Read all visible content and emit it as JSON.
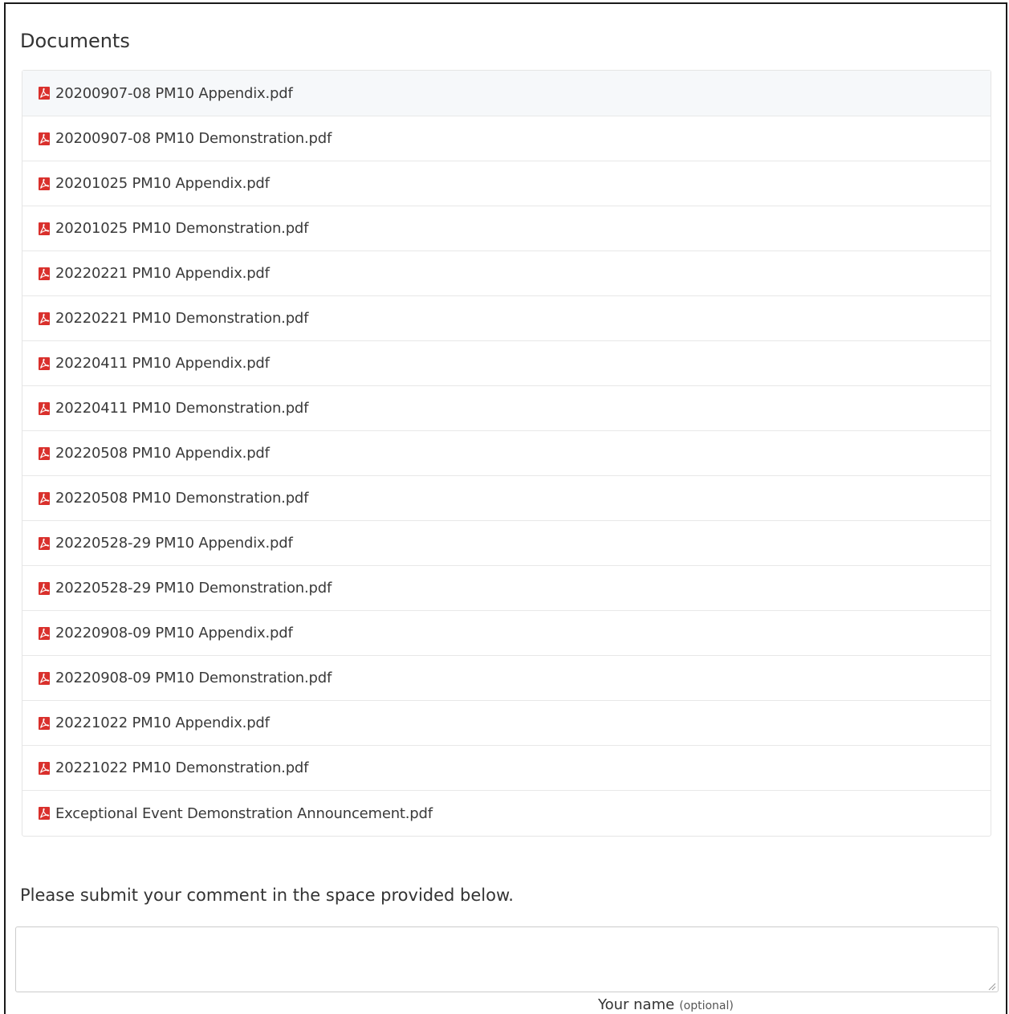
{
  "documents": {
    "title": "Documents",
    "items": [
      {
        "name": "20200907-08 PM10 Appendix.pdf",
        "icon": "pdf-icon"
      },
      {
        "name": "20200907-08 PM10 Demonstration.pdf",
        "icon": "pdf-icon"
      },
      {
        "name": "20201025 PM10 Appendix.pdf",
        "icon": "pdf-icon"
      },
      {
        "name": "20201025 PM10 Demonstration.pdf",
        "icon": "pdf-icon"
      },
      {
        "name": "20220221 PM10 Appendix.pdf",
        "icon": "pdf-icon"
      },
      {
        "name": "20220221 PM10 Demonstration.pdf",
        "icon": "pdf-icon"
      },
      {
        "name": "20220411 PM10 Appendix.pdf",
        "icon": "pdf-icon"
      },
      {
        "name": "20220411 PM10 Demonstration.pdf",
        "icon": "pdf-icon"
      },
      {
        "name": "20220508 PM10 Appendix.pdf",
        "icon": "pdf-icon"
      },
      {
        "name": "20220508 PM10 Demonstration.pdf",
        "icon": "pdf-icon"
      },
      {
        "name": "20220528-29 PM10 Appendix.pdf",
        "icon": "pdf-icon"
      },
      {
        "name": "20220528-29 PM10 Demonstration.pdf",
        "icon": "pdf-icon"
      },
      {
        "name": "20220908-09 PM10 Appendix.pdf",
        "icon": "pdf-icon"
      },
      {
        "name": "20220908-09 PM10 Demonstration.pdf",
        "icon": "pdf-icon"
      },
      {
        "name": "20221022 PM10 Appendix.pdf",
        "icon": "pdf-icon"
      },
      {
        "name": "20221022 PM10 Demonstration.pdf",
        "icon": "pdf-icon"
      },
      {
        "name": "Exceptional Event Demonstration Announcement.pdf",
        "icon": "pdf-icon"
      }
    ]
  },
  "comment": {
    "prompt": "Please submit your comment in the space provided below.",
    "value": "",
    "name_label": "Your name",
    "name_optional": "(optional)"
  },
  "colors": {
    "pdf_icon": "#d9302c",
    "text": "#3a3a3a",
    "hover_row": "#f6f8fa",
    "border": "#e5e5e5"
  }
}
